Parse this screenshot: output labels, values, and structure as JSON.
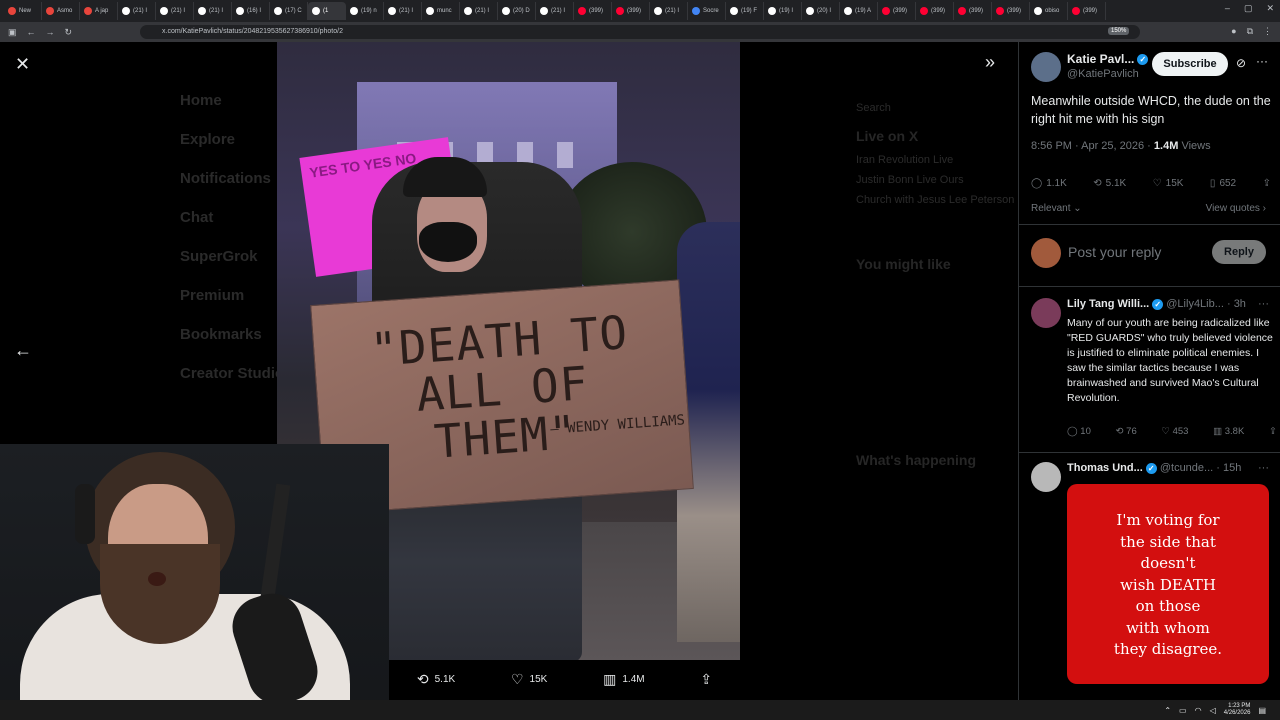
{
  "browser": {
    "tabs": [
      {
        "label": "New",
        "color": "#e8453c"
      },
      {
        "label": "Asmo",
        "color": "#e8453c"
      },
      {
        "label": "A jap",
        "color": "#e8453c"
      },
      {
        "label": "(21) I",
        "color": "#ffffff"
      },
      {
        "label": "(21) I",
        "color": "#ffffff"
      },
      {
        "label": "(21) I",
        "color": "#ffffff"
      },
      {
        "label": "(16) I",
        "color": "#ffffff"
      },
      {
        "label": "(17) C",
        "color": "#ffffff"
      },
      {
        "label": "(1",
        "color": "#ffffff",
        "active": true
      },
      {
        "label": "(19) n",
        "color": "#ffffff"
      },
      {
        "label": "(21) I",
        "color": "#ffffff"
      },
      {
        "label": "munc",
        "color": "#ffffff"
      },
      {
        "label": "(21) I",
        "color": "#ffffff"
      },
      {
        "label": "(20) D",
        "color": "#ffffff"
      },
      {
        "label": "(21) I",
        "color": "#ffffff"
      },
      {
        "label": "(399)",
        "color": "#ff0033"
      },
      {
        "label": "(399)",
        "color": "#ff0033"
      },
      {
        "label": "(21) I",
        "color": "#ffffff"
      },
      {
        "label": "Socre",
        "color": "#4285f4"
      },
      {
        "label": "(19) F",
        "color": "#ffffff"
      },
      {
        "label": "(19) I",
        "color": "#ffffff"
      },
      {
        "label": "(20) I",
        "color": "#ffffff"
      },
      {
        "label": "(19) A",
        "color": "#ffffff"
      },
      {
        "label": "(399)",
        "color": "#ff0033"
      },
      {
        "label": "(399)",
        "color": "#ff0033"
      },
      {
        "label": "(399)",
        "color": "#ff0033"
      },
      {
        "label": "(399)",
        "color": "#ff0033"
      },
      {
        "label": "obiso",
        "color": "#ffffff"
      },
      {
        "label": "(399)",
        "color": "#ff0033"
      }
    ],
    "url": "x.com/KatiePavlich/status/2048219535627386910/photo/2",
    "zoom": "150%"
  },
  "background_page": {
    "nav": [
      "Home",
      "Explore",
      "Notifications",
      "Chat",
      "SuperGrok",
      "Premium",
      "Bookmarks",
      "Creator Studio"
    ],
    "search_placeholder": "Search",
    "live_title": "Live on X",
    "live_items": [
      "Iran Revolution Live",
      "Justin Bonn Live Ours",
      "Church with Jesus Lee Peterson"
    ],
    "might_like": "You might like",
    "happening": "What's happening"
  },
  "photo": {
    "sign_text": "\"DEATH TO ALL OF THEM\"",
    "sign_sub": "— WENDY WILLIAMS",
    "pink_sign": "YES TO YES NO"
  },
  "media_bar": {
    "retweets": "5.1K",
    "likes": "15K",
    "views": "1.4M"
  },
  "tweet": {
    "author": "Katie Pavl...",
    "handle": "@KatiePavlich",
    "subscribe": "Subscribe",
    "text": "Meanwhile outside WHCD, the dude on the right hit me with his sign",
    "time": "8:56 PM · Apr 25, 2026 ·",
    "views_count": "1.4M",
    "views_label": "Views",
    "replies": "1.1K",
    "retweets": "5.1K",
    "likes": "15K",
    "bookmarks": "652",
    "relevant": "Relevant",
    "view_quotes": "View quotes",
    "reply_placeholder": "Post your reply",
    "reply_button": "Reply"
  },
  "replies": [
    {
      "name": "Lily Tang Willi...",
      "handle": "@Lily4Lib...",
      "age": "· 3h",
      "text": "Many of our youth are being radicalized like \"RED GUARDS\" who truly believed violence is justified to eliminate political enemies. I saw the similar tactics because I was brainwashed and survived Mao's Cultural Revolution.",
      "replies": "10",
      "retweets": "76",
      "likes": "453",
      "views": "3.8K"
    },
    {
      "name": "Thomas Und...",
      "handle": "@tcunde...",
      "age": "· 15h",
      "card_text": "I'm voting for\nthe side that\ndoesn't\nwish DEATH\non those\nwith whom\nthey disagree."
    }
  ],
  "taskbar": {
    "time": "1:23 PM",
    "date": "4/26/2026"
  },
  "colors": {
    "x_blue": "#1d9bf0",
    "card_red": "#d30f0f",
    "pink_sign": "#e83ad6"
  }
}
